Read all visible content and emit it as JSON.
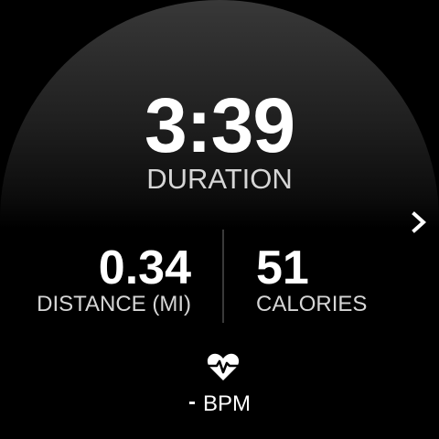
{
  "colors": {
    "background": "#000000",
    "primary_text": "#ffffff",
    "secondary_text": "#d6d6d6",
    "divider": "#3a3a3a"
  },
  "duration": {
    "value": "3:39",
    "label": "DURATION"
  },
  "distance": {
    "value": "0.34",
    "label": "DISTANCE (MI)"
  },
  "calories": {
    "value": "51",
    "label": "CALORIES"
  },
  "heart_rate": {
    "value": "-",
    "unit": "BPM",
    "icon": "heart-pulse-icon"
  },
  "navigation": {
    "next_icon": "chevron-right-icon"
  }
}
